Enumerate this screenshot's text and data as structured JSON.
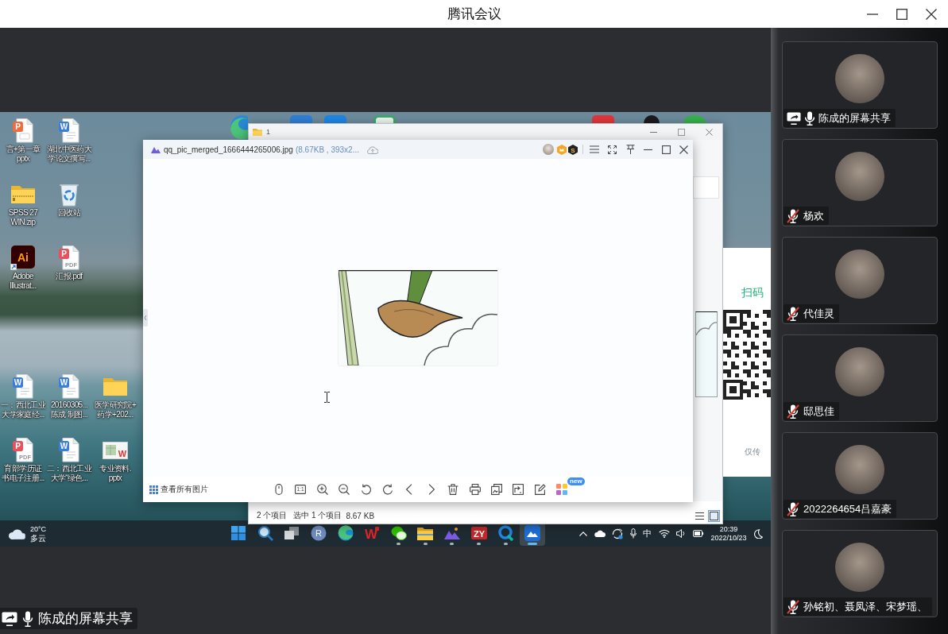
{
  "window": {
    "title": "腾讯会议"
  },
  "shared_screen": {
    "peek_icons": [
      {
        "kind": "edge",
        "color": "#2a8ad6"
      },
      {
        "kind": "tile",
        "color": "#2f7fd8"
      },
      {
        "kind": "tile",
        "color": "#1f86e6"
      },
      {
        "kind": "outline",
        "color": "#3fa86a"
      },
      {
        "kind": "tile",
        "color": "#e2363c"
      },
      {
        "kind": "penguin",
        "color": "#1b1b1d"
      },
      {
        "kind": "round",
        "color": "#36b24a"
      }
    ],
    "desktop_rows": [
      [
        {
          "kind": "ppt",
          "glyph": "P",
          "shortcut": false,
          "lines": [
            "言+第一章",
            "pptx"
          ]
        },
        {
          "kind": "word",
          "glyph": "W",
          "shortcut": false,
          "lines": [
            "湖北中医药大",
            "学论文撰写..."
          ]
        }
      ],
      [
        {
          "kind": "zip",
          "shortcut": false,
          "lines": [
            "SPSS 27",
            "WIN.zip"
          ]
        },
        {
          "kind": "recycle",
          "shortcut": false,
          "lines": [
            "回收站"
          ]
        }
      ],
      [
        {
          "kind": "ai",
          "glyph": "Ai",
          "shortcut": true,
          "lines": [
            "Adobe",
            "Illustrat..."
          ]
        },
        {
          "kind": "pdf",
          "glyph": "P",
          "tag": "PDF",
          "shortcut": false,
          "lines": [
            "汇报.pdf"
          ]
        }
      ],
      [
        {
          "kind": "word",
          "glyph": "W",
          "shortcut": false,
          "lines": [
            "一：西北工业",
            "大学家庭经..."
          ]
        },
        {
          "kind": "word",
          "glyph": "W",
          "shortcut": false,
          "lines": [
            "20160305...",
            "陈成 制图..."
          ]
        },
        {
          "kind": "folder",
          "shortcut": false,
          "lines": [
            "医学研究院+",
            "药学+202..."
          ]
        }
      ],
      [
        {
          "kind": "pdf",
          "glyph": "P",
          "tag": "PDF",
          "shortcut": false,
          "lines": [
            "育部学历证",
            "书电子注册..."
          ]
        },
        {
          "kind": "word",
          "glyph": "W",
          "shortcut": false,
          "lines": [
            "二：西北工业",
            "大学“绿色..."
          ]
        },
        {
          "kind": "slides",
          "glyph": "W",
          "shortcut": false,
          "lines": [
            "专业资料.",
            "pptx"
          ]
        }
      ]
    ],
    "explorer": {
      "title": "1",
      "item_count": "2 个项目",
      "selection": "选中 1 个项目",
      "selection_size": "8.67 KB",
      "views": [
        {
          "kind": "details",
          "selected": false
        },
        {
          "kind": "large-icons",
          "selected": true
        }
      ]
    },
    "login_window": {
      "heading": "扫码",
      "note": "仅传"
    },
    "viewer": {
      "file_name": "qq_pic_merged_1666444265006.jpg",
      "file_info": "(8.67KB , 393x2...",
      "badges": [
        {
          "kind": "crown"
        },
        {
          "kind": "letter",
          "glyph": "S"
        }
      ],
      "view_all": "查看所有图片",
      "tools": [
        {
          "kind": "mouse"
        },
        {
          "kind": "actual-size",
          "glyph": "1:1"
        },
        {
          "kind": "zoom-in"
        },
        {
          "kind": "zoom-out"
        },
        {
          "kind": "rotate-left"
        },
        {
          "kind": "rotate-right"
        },
        {
          "kind": "previous"
        },
        {
          "kind": "next"
        },
        {
          "kind": "delete"
        },
        {
          "kind": "print"
        },
        {
          "kind": "copy"
        },
        {
          "kind": "export"
        },
        {
          "kind": "edit"
        },
        {
          "kind": "apps",
          "badge": "new"
        }
      ]
    },
    "taskbar": {
      "weather": {
        "temperature": "20°C",
        "condition": "多云"
      },
      "apps": [
        {
          "kind": "start",
          "running": false,
          "selected": false
        },
        {
          "kind": "search",
          "running": false,
          "selected": false
        },
        {
          "kind": "task-view",
          "running": false,
          "selected": false
        },
        {
          "kind": "letter-circle",
          "glyph": "R",
          "running": false,
          "selected": false
        },
        {
          "kind": "edge",
          "running": false,
          "selected": false
        },
        {
          "kind": "w-logo",
          "glyph": "W",
          "running": false,
          "selected": false
        },
        {
          "kind": "chat",
          "running": true,
          "selected": false
        },
        {
          "kind": "files",
          "running": true,
          "selected": false
        },
        {
          "kind": "mountain",
          "running": true,
          "selected": false
        },
        {
          "kind": "zy",
          "glyph": "ZY",
          "running": true,
          "selected": false
        },
        {
          "kind": "q-ring",
          "running": true,
          "selected": false
        },
        {
          "kind": "viewer",
          "running": true,
          "selected": true
        }
      ],
      "tray": [
        {
          "kind": "chevron"
        },
        {
          "kind": "cloud"
        },
        {
          "kind": "sync"
        },
        {
          "kind": "mic"
        },
        {
          "kind": "ime",
          "label": "中"
        },
        {
          "kind": "wifi"
        },
        {
          "kind": "volume"
        },
        {
          "kind": "battery"
        }
      ],
      "time": "20:39",
      "date": "2022/10/23"
    }
  },
  "presenter": {
    "name": "陈成的屏幕共享",
    "sharing": true,
    "muted": false
  },
  "participants": [
    {
      "name": "陈成的屏幕共享",
      "sharing": true,
      "muted": false
    },
    {
      "name": "杨欢",
      "sharing": false,
      "muted": true
    },
    {
      "name": "代佳灵",
      "sharing": false,
      "muted": true
    },
    {
      "name": "邸思佳",
      "sharing": false,
      "muted": true
    },
    {
      "name": "2022264654吕嘉豪",
      "sharing": false,
      "muted": true
    },
    {
      "name": "孙铭初、聂凤泽、宋梦瑶、",
      "sharing": false,
      "muted": true
    }
  ]
}
